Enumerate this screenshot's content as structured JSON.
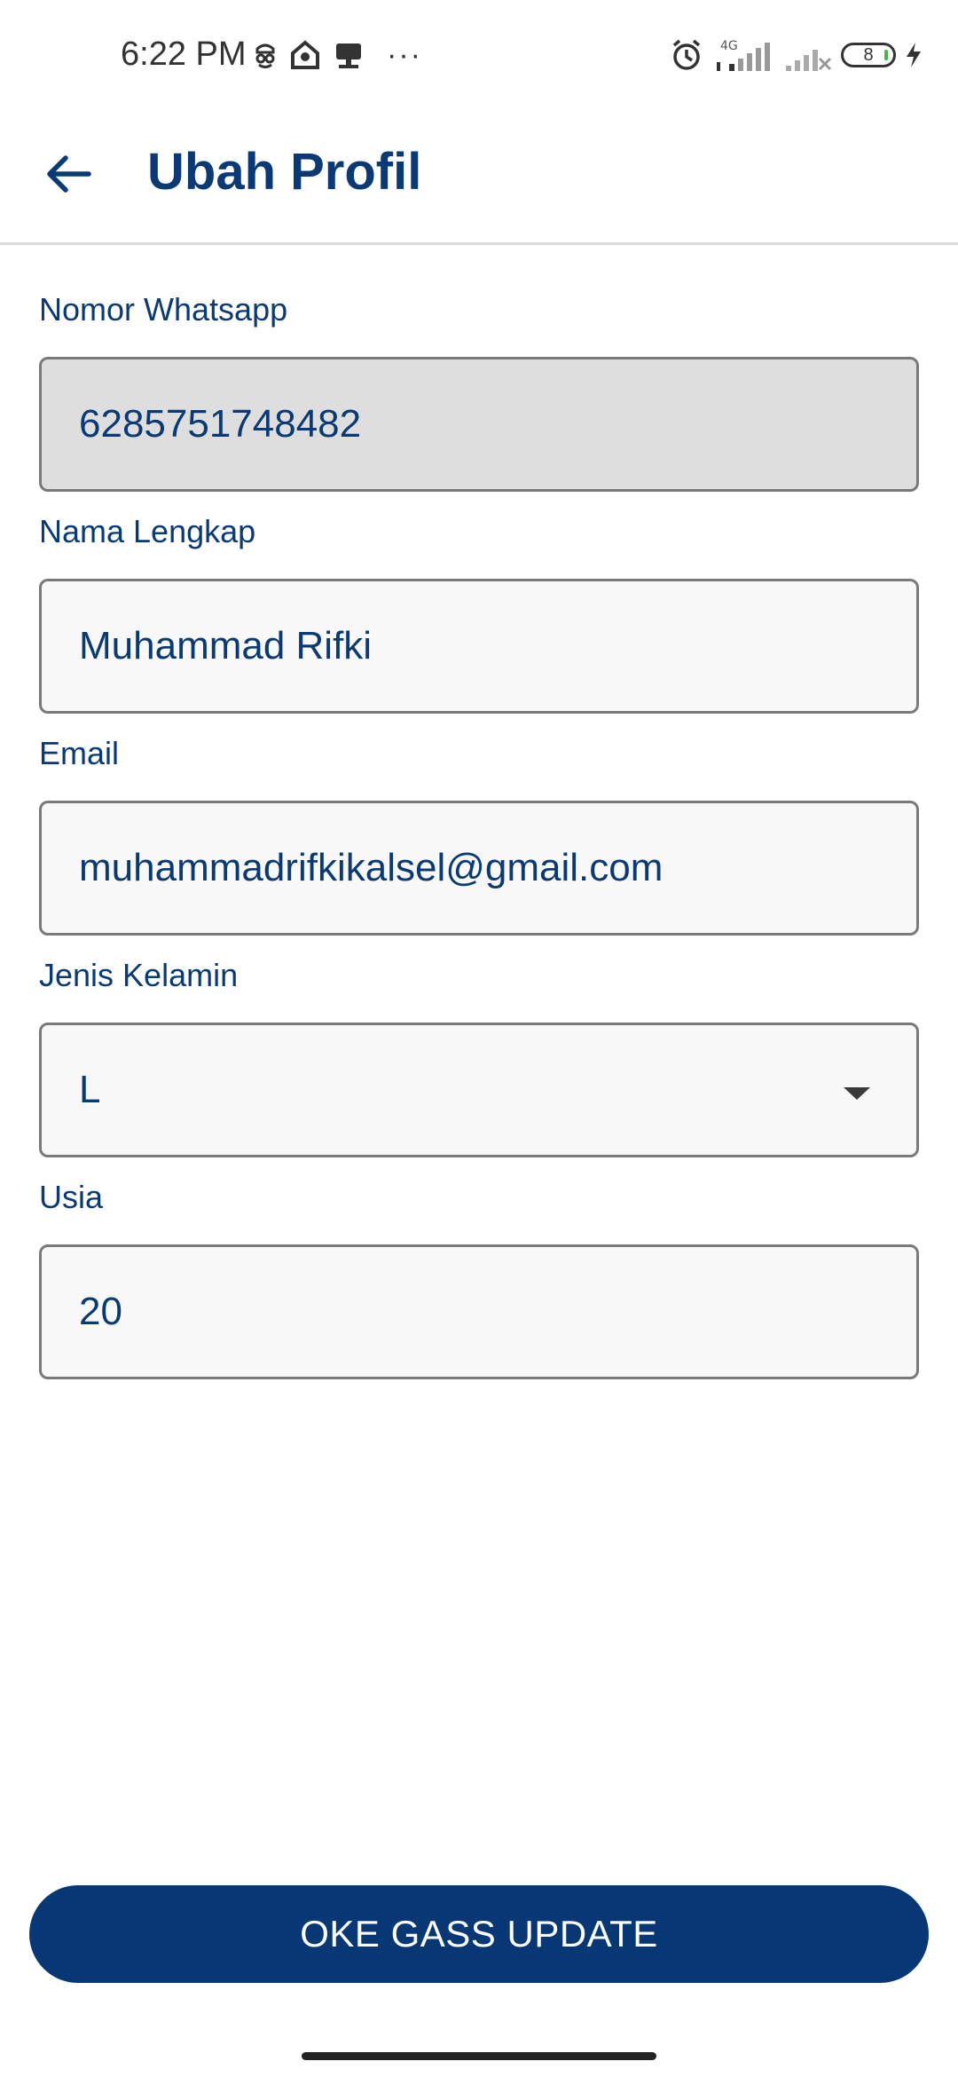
{
  "status_bar": {
    "time": "6:22 PM",
    "network": "4G",
    "battery": "8",
    "icons": [
      "incognito-icon",
      "home-app-icon",
      "cast-icon",
      "more-dots-icon",
      "alarm-icon",
      "signal-4g-icon",
      "signal-no-service-icon",
      "battery-icon",
      "charging-icon"
    ]
  },
  "app_bar": {
    "title": "Ubah Profil",
    "back_icon": "arrow-left-icon"
  },
  "form": {
    "whatsapp": {
      "label": "Nomor Whatsapp",
      "value": "6285751748482",
      "disabled": true
    },
    "fullname": {
      "label": "Nama Lengkap",
      "value": "Muhammad Rifki"
    },
    "email": {
      "label": "Email",
      "value": "muhammadrifkikalsel@gmail.com"
    },
    "gender": {
      "label": "Jenis Kelamin",
      "value": "L"
    },
    "age": {
      "label": "Usia",
      "value": "20"
    }
  },
  "submit_label": "OKE GASS UPDATE",
  "colors": {
    "primary": "#073774",
    "text": "#0a3a75",
    "disabled_bg": "#dedede",
    "field_bg": "#f8f8f8",
    "border": "#7a7a7a"
  }
}
